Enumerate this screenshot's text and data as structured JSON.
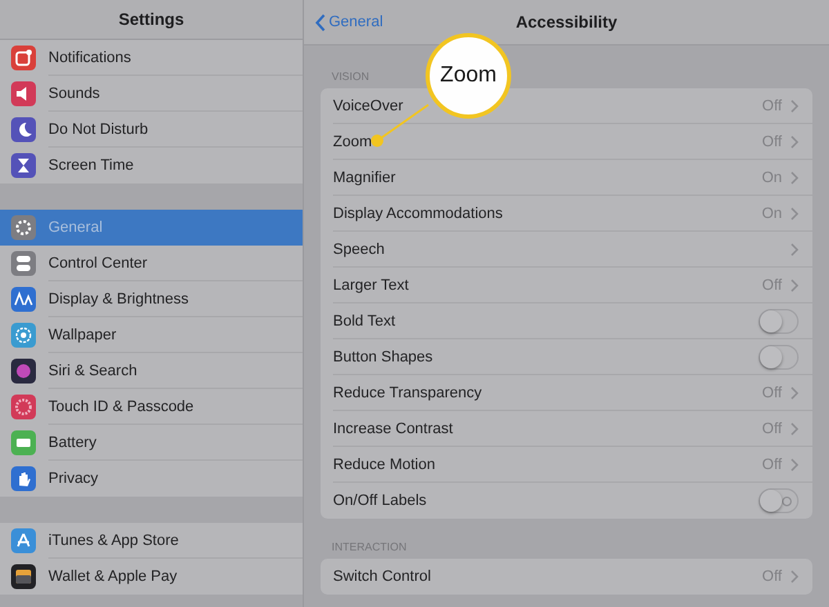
{
  "sidebar": {
    "title": "Settings",
    "groups": [
      {
        "items": [
          {
            "label": "Notifications",
            "color": "#d9403a",
            "selected": false
          },
          {
            "label": "Sounds",
            "color": "#d23a58",
            "selected": false
          },
          {
            "label": "Do Not Disturb",
            "color": "#5452b8",
            "selected": false
          },
          {
            "label": "Screen Time",
            "color": "#5452b8",
            "selected": false
          }
        ]
      },
      {
        "items": [
          {
            "label": "General",
            "color": "#7d7d82",
            "selected": true
          },
          {
            "label": "Control Center",
            "color": "#7d7d82",
            "selected": false
          },
          {
            "label": "Display & Brightness",
            "color": "#2f6fd0",
            "selected": false
          },
          {
            "label": "Wallpaper",
            "color": "#3a9bd0",
            "selected": false
          },
          {
            "label": "Siri & Search",
            "color": "#2a2a40",
            "selected": false
          },
          {
            "label": "Touch ID & Passcode",
            "color": "#d23a58",
            "selected": false
          },
          {
            "label": "Battery",
            "color": "#4cb152",
            "selected": false
          },
          {
            "label": "Privacy",
            "color": "#2f6fd0",
            "selected": false
          }
        ]
      },
      {
        "items": [
          {
            "label": "iTunes & App Store",
            "color": "#3a8fd8",
            "selected": false
          },
          {
            "label": "Wallet & Apple Pay",
            "color": "#222226",
            "selected": false
          }
        ]
      }
    ]
  },
  "detail": {
    "back": "General",
    "title": "Accessibility",
    "sections": [
      {
        "header": "VISION",
        "rows": [
          {
            "kind": "link",
            "label": "VoiceOver",
            "value": "Off"
          },
          {
            "kind": "link",
            "label": "Zoom",
            "value": "Off"
          },
          {
            "kind": "link",
            "label": "Magnifier",
            "value": "On"
          },
          {
            "kind": "link",
            "label": "Display Accommodations",
            "value": "On"
          },
          {
            "kind": "link",
            "label": "Speech"
          },
          {
            "kind": "link",
            "label": "Larger Text",
            "value": "Off"
          },
          {
            "kind": "toggle",
            "label": "Bold Text",
            "on": false
          },
          {
            "kind": "toggle",
            "label": "Button Shapes",
            "on": false
          },
          {
            "kind": "link",
            "label": "Reduce Transparency",
            "value": "Off"
          },
          {
            "kind": "link",
            "label": "Increase Contrast",
            "value": "Off"
          },
          {
            "kind": "link",
            "label": "Reduce Motion",
            "value": "Off"
          },
          {
            "kind": "labeled_toggle",
            "label": "On/Off Labels",
            "on": false
          }
        ]
      },
      {
        "header": "INTERACTION",
        "rows": [
          {
            "kind": "link",
            "label": "Switch Control",
            "value": "Off"
          }
        ]
      }
    ]
  },
  "callout": {
    "text": "Zoom"
  }
}
